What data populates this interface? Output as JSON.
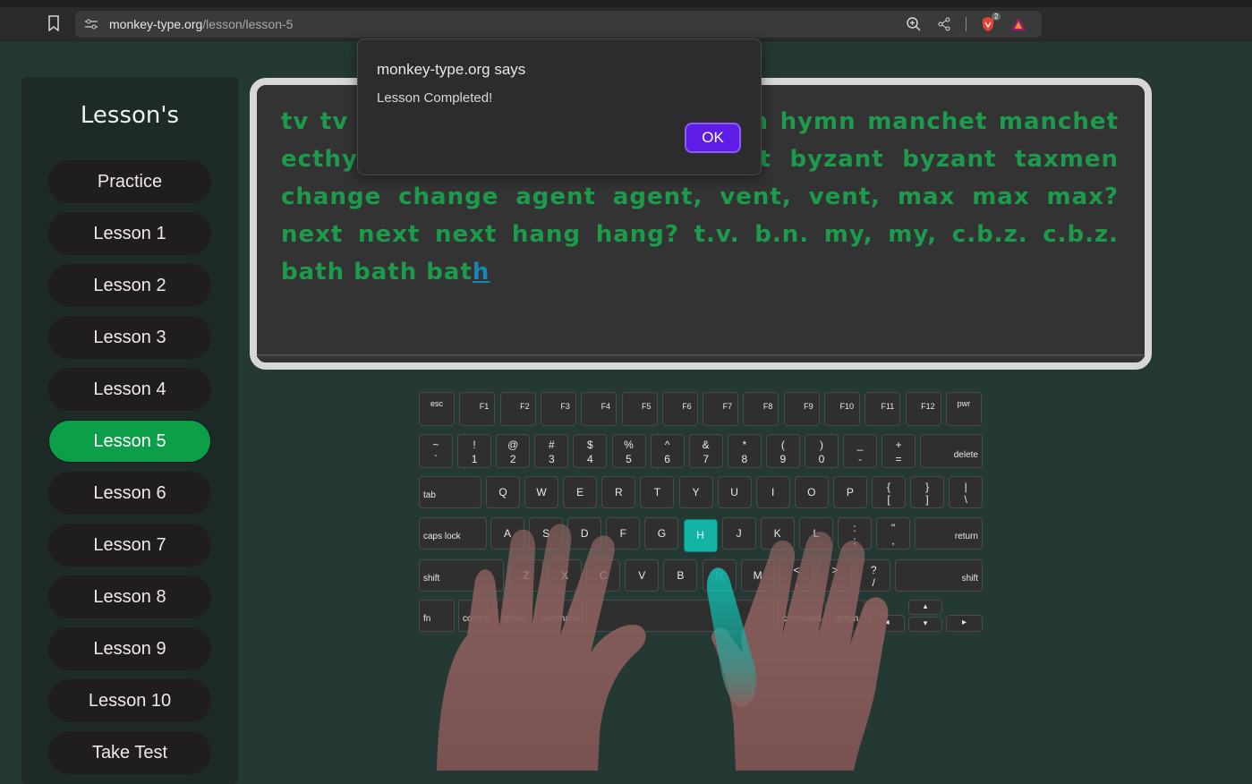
{
  "browser": {
    "url_domain": "monkey-type.org",
    "url_path": "/lesson/lesson-5",
    "shield_badge": "2"
  },
  "sidebar": {
    "title": "Lesson's",
    "items": [
      {
        "label": "Practice",
        "active": false
      },
      {
        "label": "Lesson 1",
        "active": false
      },
      {
        "label": "Lesson 2",
        "active": false
      },
      {
        "label": "Lesson 3",
        "active": false
      },
      {
        "label": "Lesson 4",
        "active": false
      },
      {
        "label": "Lesson 5",
        "active": true
      },
      {
        "label": "Lesson 6",
        "active": false
      },
      {
        "label": "Lesson 7",
        "active": false
      },
      {
        "label": "Lesson 8",
        "active": false
      },
      {
        "label": "Lesson 9",
        "active": false
      },
      {
        "label": "Lesson 10",
        "active": false
      },
      {
        "label": "Take Test",
        "active": false
      }
    ]
  },
  "lesson": {
    "text_before_dialog": "tv tv ",
    "text_main": "myth myth myth hymn hymn hymn manchet manchet ecthyma ecthyma taxmen byzant byzant byzant taxmen change change agent agent, vent, vent, max max max? next next next hang hang? t.v. b.n. my, my, c.b.z. c.b.z. bath bath bat",
    "cursor_char": "h",
    "text_color": "#1e9a4c",
    "cursor_color": "#1786b4"
  },
  "dialog": {
    "title": "monkey-type.org says",
    "message": "Lesson Completed!",
    "ok_label": "OK"
  },
  "keyboard": {
    "highlight_key": "H",
    "highlight_color": "#14b3a6",
    "row_fn": [
      "esc",
      "F1",
      "F2",
      "F3",
      "F4",
      "F5",
      "F6",
      "F7",
      "F8",
      "F9",
      "F10",
      "F11",
      "F12",
      "pwr"
    ],
    "row_num": [
      {
        "top": "~",
        "bot": "`"
      },
      {
        "top": "!",
        "bot": "1"
      },
      {
        "top": "@",
        "bot": "2"
      },
      {
        "top": "#",
        "bot": "3"
      },
      {
        "top": "$",
        "bot": "4"
      },
      {
        "top": "%",
        "bot": "5"
      },
      {
        "top": "^",
        "bot": "6"
      },
      {
        "top": "&",
        "bot": "7"
      },
      {
        "top": "*",
        "bot": "8"
      },
      {
        "top": "(",
        "bot": "9"
      },
      {
        "top": ")",
        "bot": "0"
      },
      {
        "top": "_",
        "bot": "-"
      },
      {
        "top": "+",
        "bot": "="
      }
    ],
    "delete": "delete",
    "tab": "tab",
    "row_q": [
      "Q",
      "W",
      "E",
      "R",
      "T",
      "Y",
      "U",
      "I",
      "O",
      "P"
    ],
    "row_q_sym": [
      {
        "top": "{",
        "bot": "["
      },
      {
        "top": "}",
        "bot": "]"
      },
      {
        "top": "|",
        "bot": "\\"
      }
    ],
    "caps": "caps lock",
    "row_a": [
      "A",
      "S",
      "D",
      "F",
      "G",
      "H",
      "J",
      "K",
      "L"
    ],
    "row_a_sym": [
      {
        "top": ":",
        "bot": ";"
      },
      {
        "top": "\"",
        "bot": ","
      }
    ],
    "return": "return",
    "shift": "shift",
    "row_z": [
      "Z",
      "X",
      "C",
      "V",
      "B",
      "N",
      "M"
    ],
    "row_z_sym": [
      {
        "top": "<",
        "bot": ","
      },
      {
        "top": ">",
        "bot": "."
      },
      {
        "top": "?",
        "bot": "/"
      }
    ],
    "fn": "fn",
    "control": "control",
    "option": "option",
    "command": "command",
    "arrow_left": "◂",
    "arrow_up": "▴",
    "arrow_down": "▾",
    "arrow_right": "▸"
  }
}
